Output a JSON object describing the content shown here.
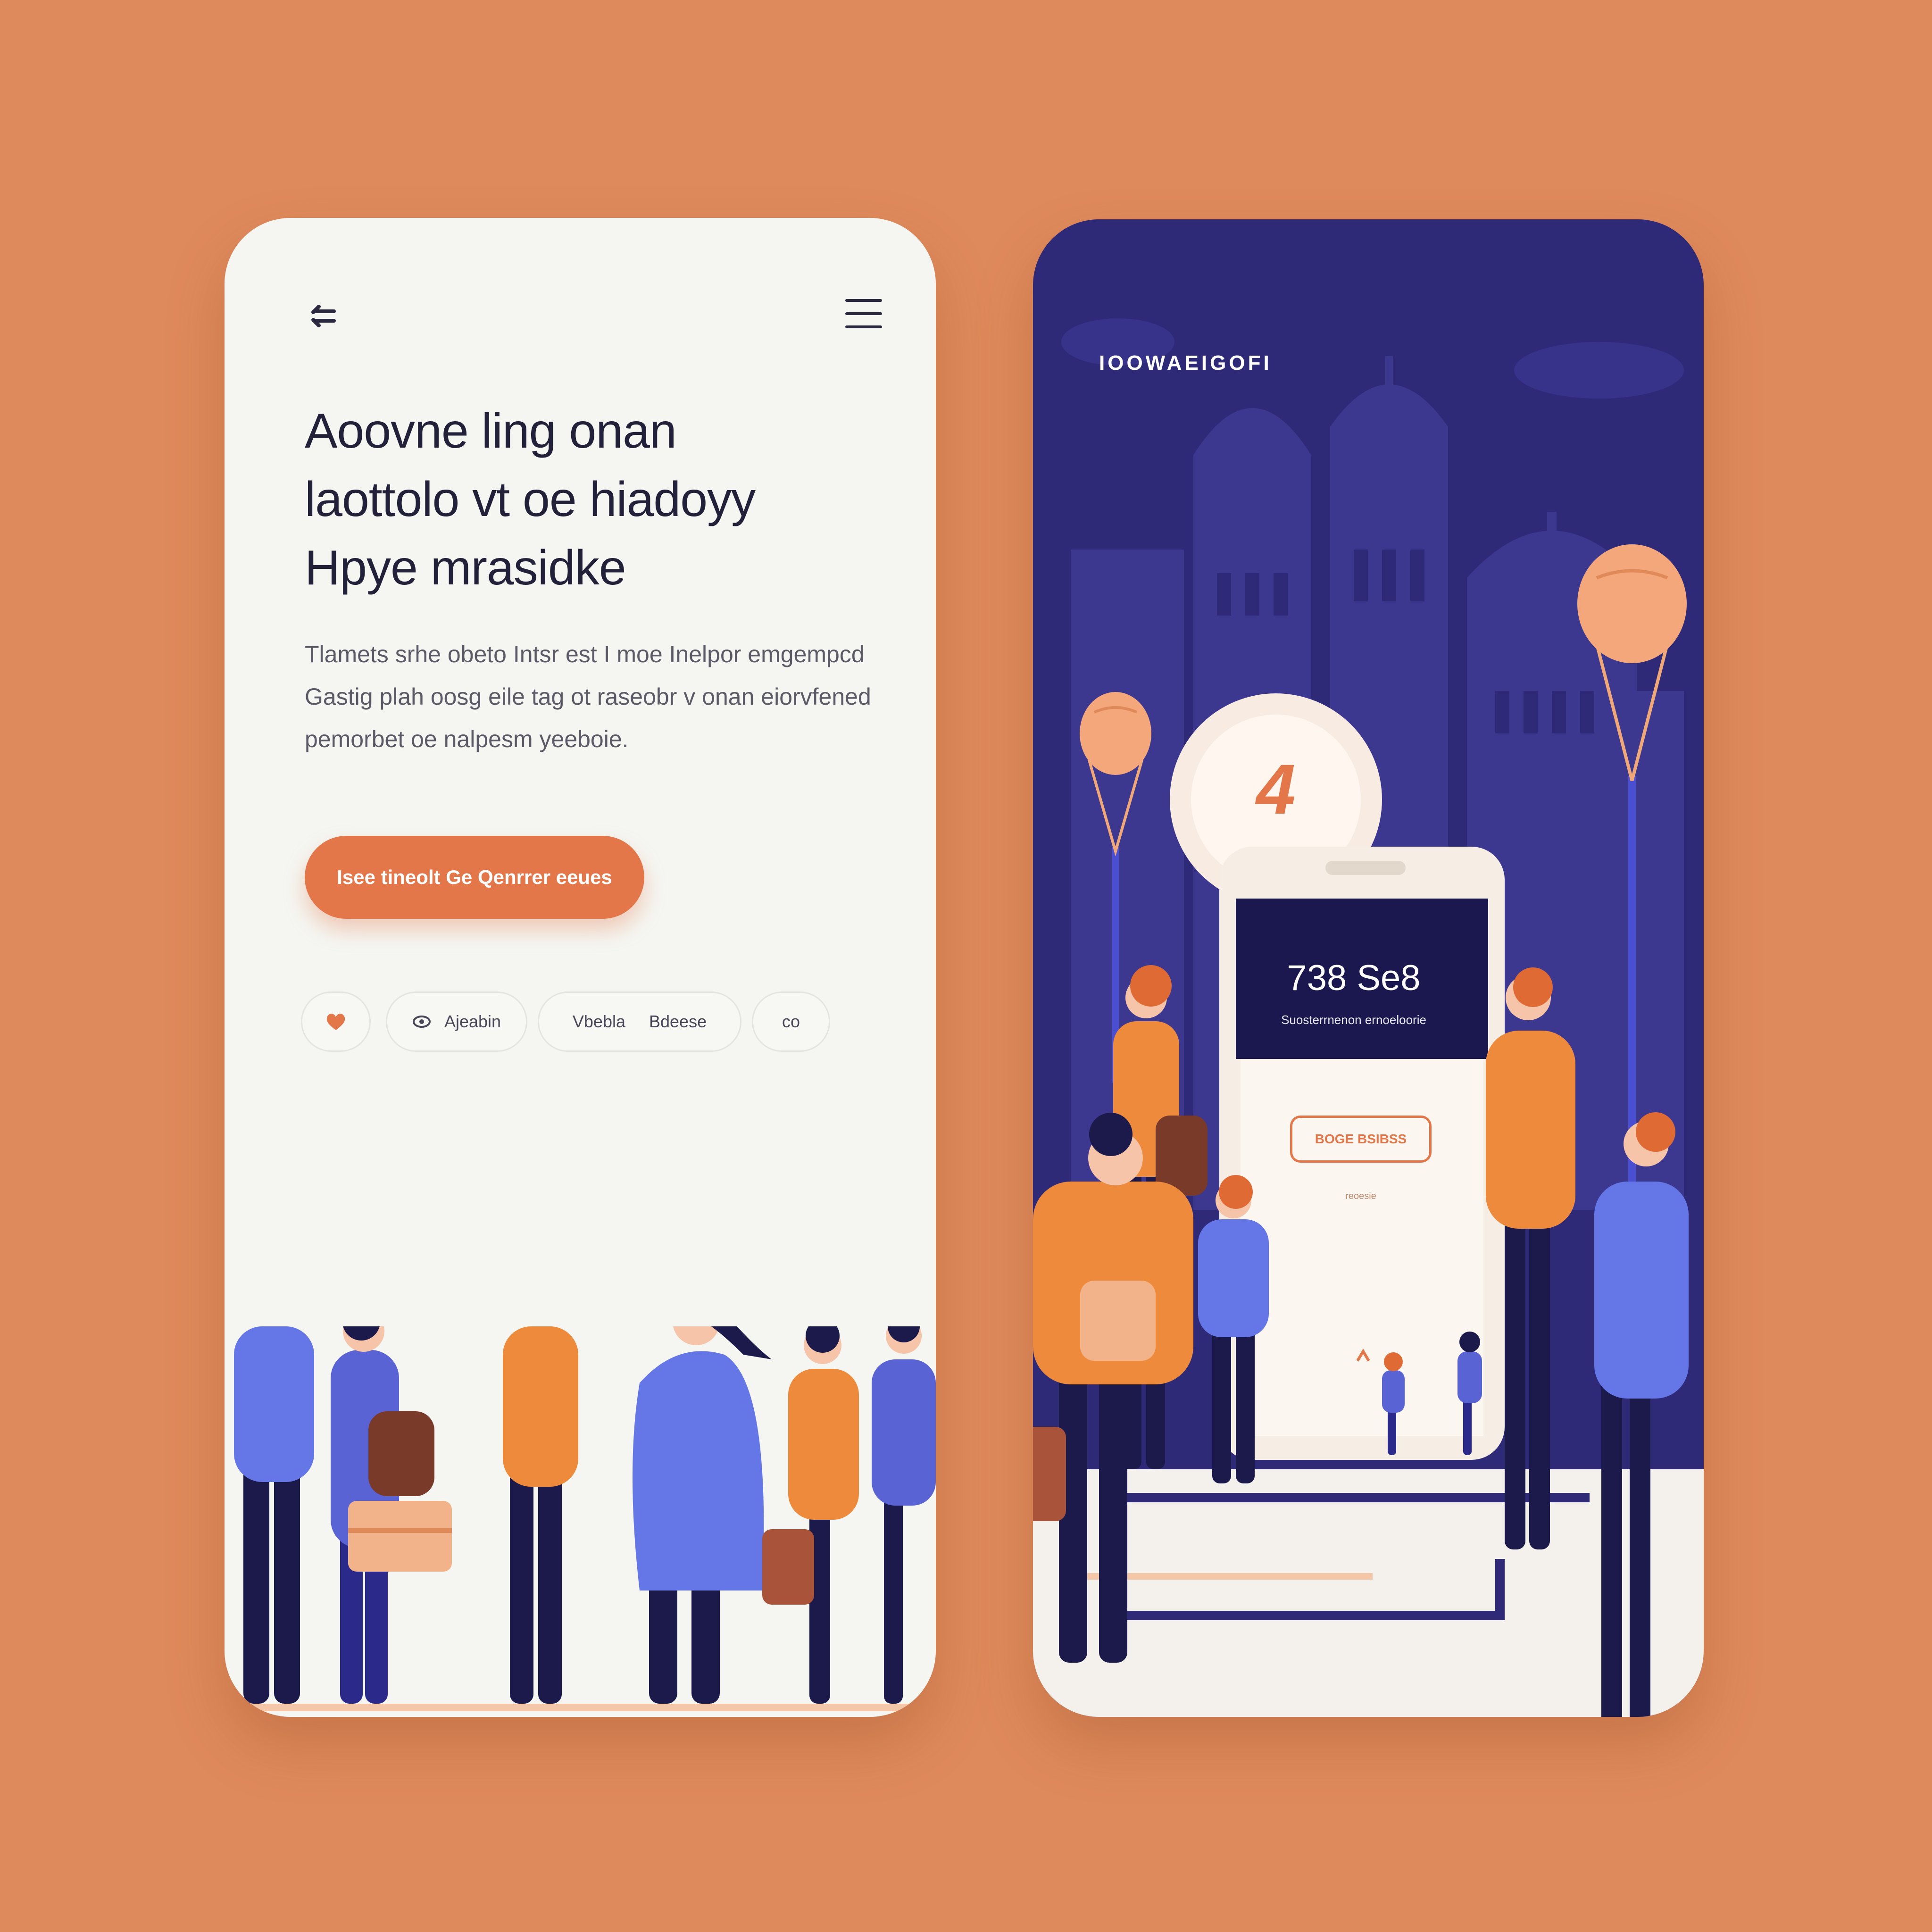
{
  "colors": {
    "background": "#df8a5c",
    "accent": "#e4774a",
    "navy": "#2e2a78",
    "figure_blue": "#6576e6",
    "figure_orange": "#ee8a3c",
    "ink": "#23213a",
    "card": "#f5f6f2"
  },
  "left_screen": {
    "back_icon": "back-icon",
    "menu_icon": "menu-icon",
    "headline_lines": [
      "Aoovne ling onan",
      "laottolo vt oe hiadoyy",
      "Hpye mrasidke"
    ],
    "body_lines": [
      "Tlamets srhe obeto Intsr est I moe Inelpor emgempcd",
      "Gastig plah oosg eile tag ot raseobr v onan eiorvfened",
      "pemorbet oe nalpesm yeeboie."
    ],
    "cta_label": "Isee tineolt Ge Qenrrer eeues",
    "chips": [
      {
        "icon": "heart-icon",
        "label": ""
      },
      {
        "icon": "eye-icon",
        "label": "Ajeabin"
      },
      {
        "icon": "",
        "label": "Vbebla     Bdeese"
      },
      {
        "icon": "",
        "label": "co"
      }
    ]
  },
  "right_screen": {
    "city_label": "IOOWAEIGOFI",
    "balloon_number": "4",
    "phone_balance": "738 Se8",
    "phone_caption": "Suosterrnenon ernoeloorie",
    "phone_button": "BOGE BSIBSS",
    "phone_link": "reoesie"
  }
}
